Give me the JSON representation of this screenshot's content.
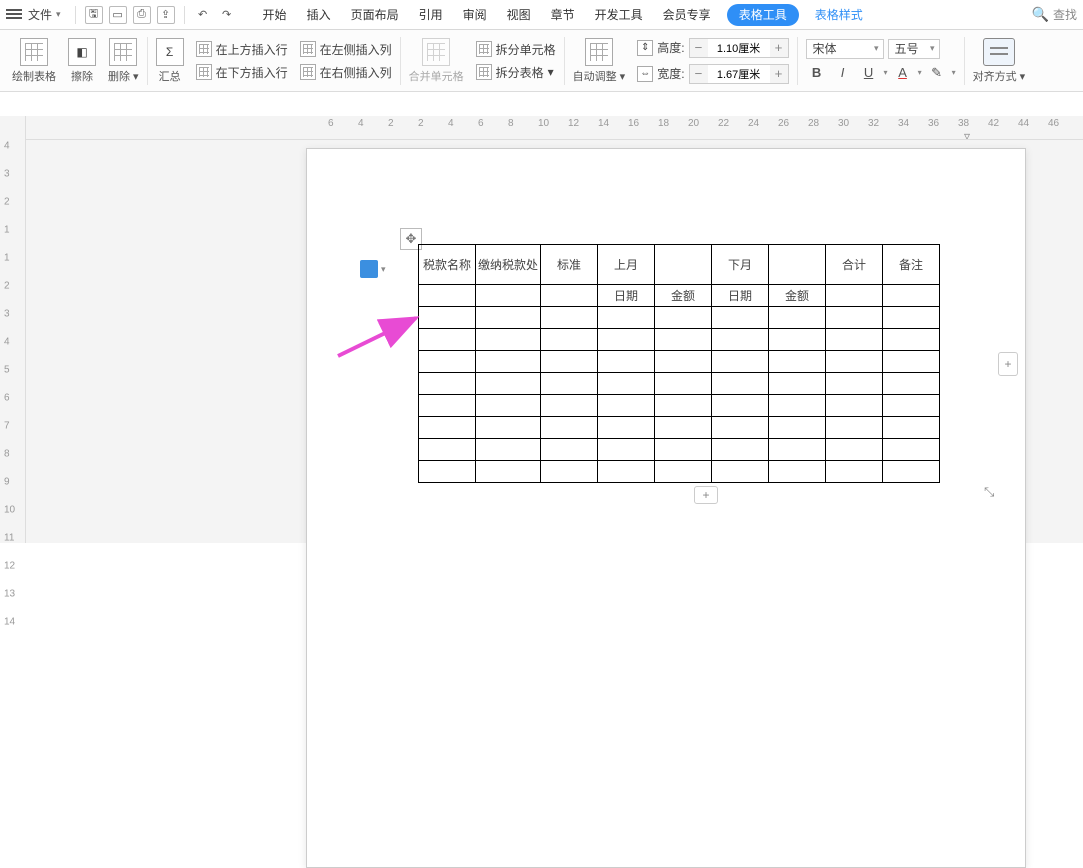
{
  "top": {
    "file": "文件",
    "tabs": [
      "开始",
      "插入",
      "页面布局",
      "引用",
      "审阅",
      "视图",
      "章节",
      "开发工具",
      "会员专享"
    ],
    "tool_pill": "表格工具",
    "tool_link": "表格样式",
    "search": "查找"
  },
  "ribbon": {
    "draw": "绘制表格",
    "erase": "擦除",
    "delete": "删除",
    "summary": "汇总",
    "ins_above": "在上方插入行",
    "ins_below": "在下方插入行",
    "ins_left": "在左侧插入列",
    "ins_right": "在右侧插入列",
    "merge": "合并单元格",
    "split_cell": "拆分单元格",
    "split_table": "拆分表格",
    "autofit": "自动调整",
    "height_label": "高度:",
    "height_val": "1.10厘米",
    "width_label": "宽度:",
    "width_val": "1.67厘米",
    "font": "宋体",
    "size": "五号",
    "align": "对齐方式"
  },
  "hruler": [
    6,
    4,
    2,
    2,
    4,
    6,
    8,
    10,
    12,
    14,
    16,
    18,
    20,
    22,
    24,
    26,
    28,
    30,
    32,
    34,
    36,
    38,
    42,
    44,
    46
  ],
  "vruler": [
    4,
    3,
    2,
    1,
    1,
    2,
    3,
    4,
    5,
    6,
    7,
    8,
    9,
    10,
    11,
    12,
    13,
    14
  ],
  "table": {
    "h1": [
      "税款名称",
      "缴纳税款处",
      "标准",
      "上月",
      "",
      "下月",
      "",
      "合计",
      "备注"
    ],
    "h2": [
      "",
      "",
      "",
      "日期",
      "金额",
      "日期",
      "金额",
      "",
      ""
    ]
  }
}
